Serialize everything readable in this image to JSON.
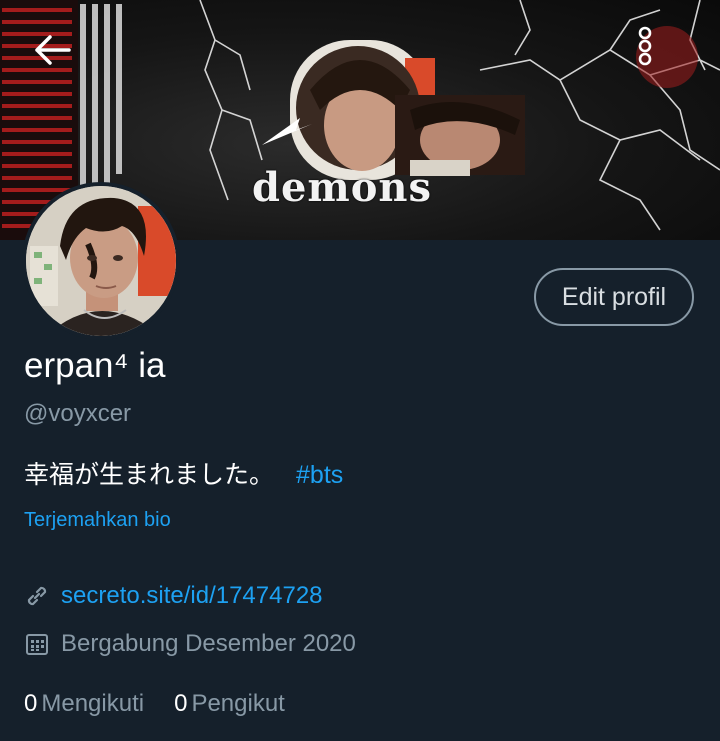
{
  "banner": {
    "title_text": "demons",
    "colors": {
      "background": "#151515",
      "accent_red": "#b31e1e",
      "lightning": "#e8e8e8"
    }
  },
  "header": {
    "back_icon": "arrow-left-icon",
    "more_icon": "more-vertical-icon"
  },
  "profile": {
    "display_name": "erpan⁴ ia",
    "handle": "@voyxcer",
    "bio_text": "幸福が生まれました。",
    "bio_hashtag": "#bts",
    "translate_label": "Terjemahkan bio",
    "website": "secreto.site/id/17474728",
    "joined": "Bergabung Desember 2020",
    "link_icon": "link-icon",
    "calendar_icon": "calendar-icon"
  },
  "actions": {
    "edit_label": "Edit profil"
  },
  "stats": {
    "following_count": "0",
    "following_label": "Mengikuti",
    "followers_count": "0",
    "followers_label": "Pengikut"
  },
  "theme": {
    "background": "#15202b",
    "text_primary": "#ffffff",
    "text_secondary": "#8899a6",
    "link": "#1da1f2"
  }
}
